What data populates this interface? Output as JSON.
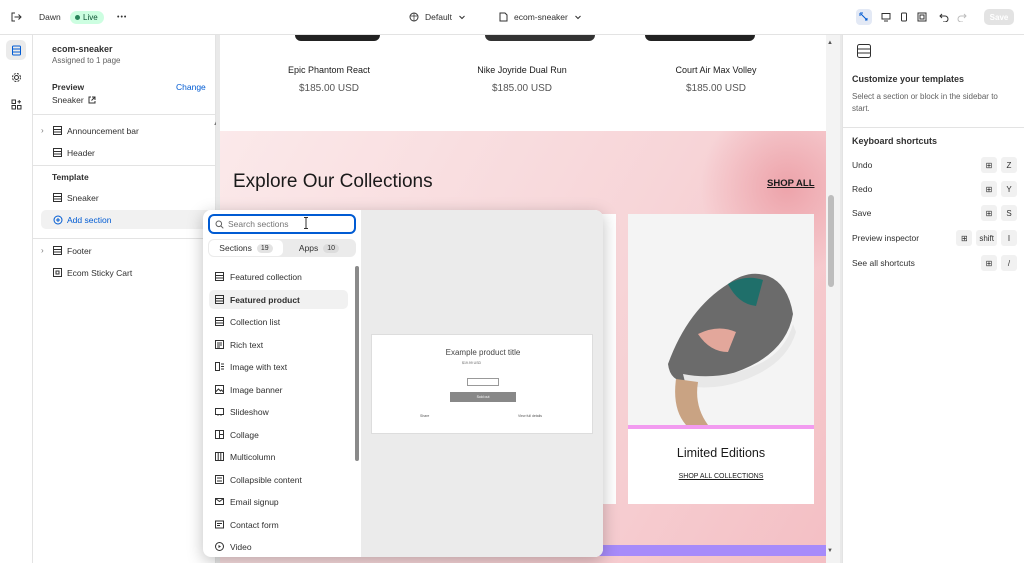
{
  "topbar": {
    "store_name": "Dawn",
    "live_label": "Live",
    "more_label": "•••",
    "theme_selector": "Default",
    "template_selector": "ecom-sneaker",
    "save_label": "Save"
  },
  "sidebar": {
    "template_name": "ecom-sneaker",
    "assigned": "Assigned to 1 page",
    "preview_label": "Preview",
    "preview_change": "Change",
    "preview_value": "Sneaker",
    "header_items": [
      {
        "label": "Announcement bar"
      },
      {
        "label": "Header"
      }
    ],
    "template_label": "Template",
    "template_items": [
      {
        "label": "Sneaker"
      },
      {
        "label": "Add section"
      }
    ],
    "footer_items": [
      {
        "label": "Footer"
      },
      {
        "label": "Ecom Sticky Cart"
      }
    ]
  },
  "preview": {
    "products": [
      {
        "name": "Epic Phantom React",
        "price": "$185.00 USD"
      },
      {
        "name": "Nike Joyride Dual Run",
        "price": "$185.00 USD"
      },
      {
        "name": "Court Air Max Volley",
        "price": "$185.00 USD"
      }
    ],
    "collections_title": "Explore Our Collections",
    "shop_all": "SHOP ALL",
    "card_title": "Limited Editions",
    "card_link": "SHOP ALL COLLECTIONS"
  },
  "popup": {
    "search_placeholder": "Search sections",
    "tabs": [
      {
        "label": "Sections",
        "count": "19"
      },
      {
        "label": "Apps",
        "count": "10"
      }
    ],
    "items": [
      {
        "label": "Featured collection"
      },
      {
        "label": "Featured product"
      },
      {
        "label": "Collection list"
      },
      {
        "label": "Rich text"
      },
      {
        "label": "Image with text"
      },
      {
        "label": "Image banner"
      },
      {
        "label": "Slideshow"
      },
      {
        "label": "Collage"
      },
      {
        "label": "Multicolumn"
      },
      {
        "label": "Collapsible content"
      },
      {
        "label": "Email signup"
      },
      {
        "label": "Contact form"
      },
      {
        "label": "Video"
      }
    ],
    "preview_card": {
      "title": "Example product title",
      "price": "$19.99 USD",
      "button": "Sold out",
      "share": "Share",
      "details": "View full details"
    }
  },
  "right_panel": {
    "title": "Customize your templates",
    "desc": "Select a section or block in the sidebar to start.",
    "shortcuts_title": "Keyboard shortcuts",
    "shortcuts": [
      {
        "label": "Undo",
        "keys": [
          "⊞",
          "Z"
        ]
      },
      {
        "label": "Redo",
        "keys": [
          "⊞",
          "Y"
        ]
      },
      {
        "label": "Save",
        "keys": [
          "⊞",
          "S"
        ]
      },
      {
        "label": "Preview inspector",
        "keys": [
          "⊞",
          "shift",
          "I"
        ]
      },
      {
        "label": "See all shortcuts",
        "keys": [
          "⊞",
          "/"
        ]
      }
    ]
  },
  "colors": {
    "accent": "#005bd3",
    "live_bg": "#cdfee1",
    "hero_pink": "#f7d5d8",
    "card_stripe": "#f29bf0",
    "bottom_bar": "#a78bfa"
  }
}
